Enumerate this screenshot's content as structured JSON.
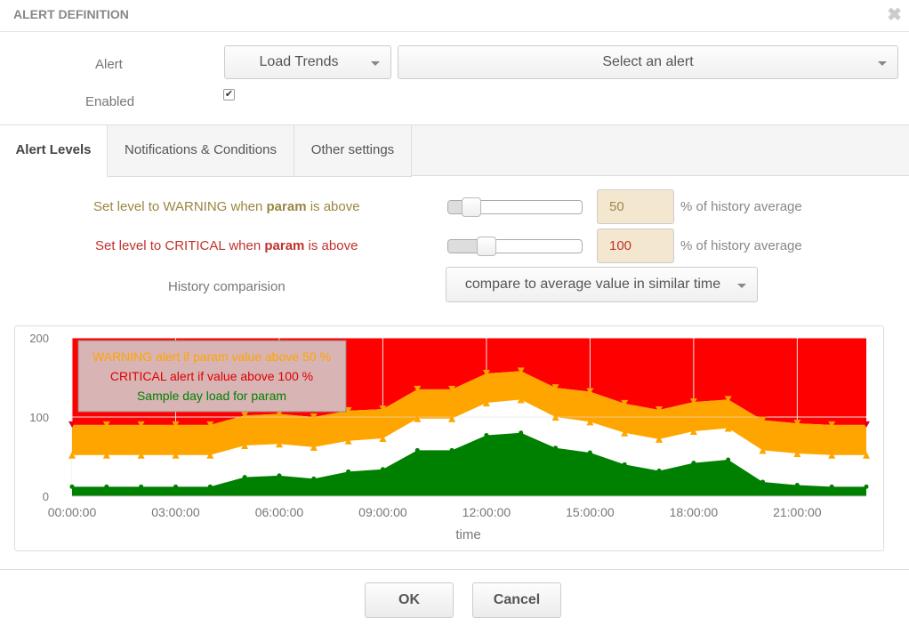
{
  "dialog": {
    "title": "ALERT DEFINITION",
    "close_icon": "✖"
  },
  "form": {
    "alert_label": "Alert",
    "alert_type": "Load Trends",
    "alert_select": "Select an alert",
    "enabled_label": "Enabled",
    "enabled": true,
    "check_mark": "✔"
  },
  "tabs": [
    {
      "label": "Alert Levels",
      "active": true
    },
    {
      "label": "Notifications & Conditions",
      "active": false
    },
    {
      "label": "Other settings",
      "active": false
    }
  ],
  "levels": {
    "warning": {
      "prefix": "Set level to WARNING when ",
      "param": "param",
      "suffix": " is above",
      "value": "50",
      "slider_fraction": 0.12,
      "unit": "% of history average"
    },
    "critical": {
      "prefix": "Set level to CRITICAL when ",
      "param": "param",
      "suffix": " is above",
      "value": "100",
      "slider_fraction": 0.25,
      "unit": "% of history average"
    }
  },
  "history": {
    "label": "History comparision",
    "value": "compare to average value in similar time"
  },
  "colors": {
    "critical": "#ff0000",
    "warning": "#ffa500",
    "normal": "#ffffff",
    "load": "#008000"
  },
  "chart_data": {
    "type": "area",
    "x": [
      "00:00",
      "01:00",
      "02:00",
      "03:00",
      "04:00",
      "05:00",
      "06:00",
      "07:00",
      "08:00",
      "09:00",
      "10:00",
      "11:00",
      "12:00",
      "13:00",
      "14:00",
      "15:00",
      "16:00",
      "17:00",
      "18:00",
      "19:00",
      "20:00",
      "21:00",
      "22:00",
      "23:00"
    ],
    "series": [
      {
        "values": [
          12,
          12,
          12,
          12,
          12,
          24,
          26,
          22,
          31,
          34,
          58,
          58,
          77,
          80,
          61,
          55,
          40,
          32,
          42,
          46,
          18,
          14,
          12,
          12
        ]
      },
      {
        "values": [
          52,
          52,
          52,
          52,
          52,
          64,
          66,
          62,
          70,
          73,
          98,
          98,
          118,
          122,
          100,
          94,
          80,
          72,
          82,
          86,
          58,
          54,
          52,
          52
        ]
      },
      {
        "values": [
          90,
          90,
          90,
          90,
          90,
          102,
          104,
          100,
          108,
          110,
          135,
          135,
          155,
          158,
          137,
          132,
          117,
          109,
          119,
          122,
          96,
          92,
          90,
          90
        ]
      }
    ],
    "xticks": [
      "00:00:00",
      "03:00:00",
      "06:00:00",
      "09:00:00",
      "12:00:00",
      "15:00:00",
      "18:00:00",
      "21:00:00"
    ],
    "yticks": [
      "0",
      "100",
      "200"
    ],
    "ylim": [
      0,
      200
    ],
    "xlabel": "time",
    "legend": [
      "WARNING alert if param value above 50 %",
      "CRITICAL alert if value above 100 %",
      "Sample day load for param"
    ],
    "legend_placement": "top-left",
    "grid": true
  },
  "buttons": {
    "ok": "OK",
    "cancel": "Cancel"
  }
}
